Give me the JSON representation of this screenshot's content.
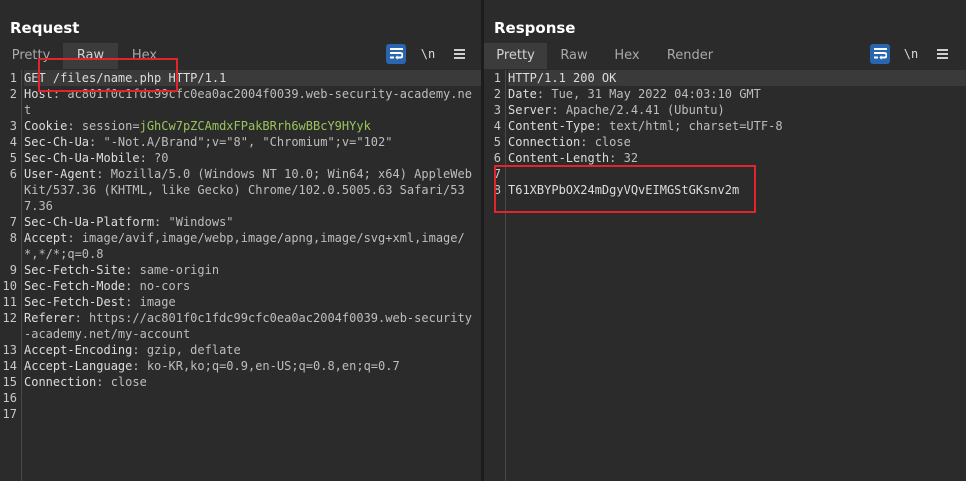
{
  "request": {
    "title": "Request",
    "tabs": [
      {
        "label": "Pretty",
        "active": false
      },
      {
        "label": "Raw",
        "active": true
      },
      {
        "label": "Hex",
        "active": false
      }
    ],
    "newline_label": "\\n",
    "lines": [
      {
        "n": "1",
        "key": "GET /files/name.php HTTP/1.1",
        "val": ""
      },
      {
        "n": "2",
        "key": "Host",
        "val": "ac801f0c1fdc99cfc0ea0ac2004f0039.web-security-academy.net"
      },
      {
        "n": "3",
        "key": "Cookie",
        "val": "session=jGhCw7pZCAmdxFPakBRrh6wBBcY9HYyk"
      },
      {
        "n": "4",
        "key": "Sec-Ch-Ua",
        "val": "\"-Not.A/Brand\";v=\"8\", \"Chromium\";v=\"102\""
      },
      {
        "n": "5",
        "key": "Sec-Ch-Ua-Mobile",
        "val": "?0"
      },
      {
        "n": "6",
        "key": "User-Agent",
        "val": "Mozilla/5.0 (Windows NT 10.0; Win64; x64) AppleWebKit/537.36 (KHTML, like Gecko) Chrome/102.0.5005.63 Safari/537.36"
      },
      {
        "n": "7",
        "key": "Sec-Ch-Ua-Platform",
        "val": "\"Windows\""
      },
      {
        "n": "8",
        "key": "Accept",
        "val": "image/avif,image/webp,image/apng,image/svg+xml,image/*,*/*;q=0.8"
      },
      {
        "n": "9",
        "key": "Sec-Fetch-Site",
        "val": "same-origin"
      },
      {
        "n": "10",
        "key": "Sec-Fetch-Mode",
        "val": "no-cors"
      },
      {
        "n": "11",
        "key": "Sec-Fetch-Dest",
        "val": "image"
      },
      {
        "n": "12",
        "key": "Referer",
        "val": "https://ac801f0c1fdc99cfc0ea0ac2004f0039.web-security-academy.net/my-account"
      },
      {
        "n": "13",
        "key": "Accept-Encoding",
        "val": "gzip, deflate"
      },
      {
        "n": "14",
        "key": "Accept-Language",
        "val": "ko-KR,ko;q=0.9,en-US;q=0.8,en;q=0.7"
      },
      {
        "n": "15",
        "key": "Connection",
        "val": "close"
      },
      {
        "n": "16",
        "key": "",
        "val": ""
      },
      {
        "n": "17",
        "key": "",
        "val": ""
      }
    ]
  },
  "response": {
    "title": "Response",
    "tabs": [
      {
        "label": "Pretty",
        "active": true
      },
      {
        "label": "Raw",
        "active": false
      },
      {
        "label": "Hex",
        "active": false
      },
      {
        "label": "Render",
        "active": false
      }
    ],
    "newline_label": "\\n",
    "lines": [
      {
        "n": "1",
        "key": "HTTP/1.1 200 OK",
        "val": ""
      },
      {
        "n": "2",
        "key": "Date",
        "val": "Tue, 31 May 2022 04:03:10 GMT"
      },
      {
        "n": "3",
        "key": "Server",
        "val": "Apache/2.4.41 (Ubuntu)"
      },
      {
        "n": "4",
        "key": "Content-Type",
        "val": "text/html; charset=UTF-8"
      },
      {
        "n": "5",
        "key": "Connection",
        "val": "close"
      },
      {
        "n": "6",
        "key": "Content-Length",
        "val": "32"
      },
      {
        "n": "7",
        "key": "",
        "val": ""
      },
      {
        "n": "8",
        "key": "T61XBYPbOX24mDgyVQvEIMGStGKsnv2m",
        "val": ""
      }
    ]
  },
  "icons": {
    "wrap": "word-wrap-icon",
    "menu": "hamburger-menu-icon",
    "layout": [
      "split-horizontal-icon",
      "split-vertical-icon",
      "single-pane-icon"
    ]
  },
  "colors": {
    "accent": "#2a65b0",
    "highlight_box": "#e0262c",
    "cookie_value": "#9bc45c"
  }
}
